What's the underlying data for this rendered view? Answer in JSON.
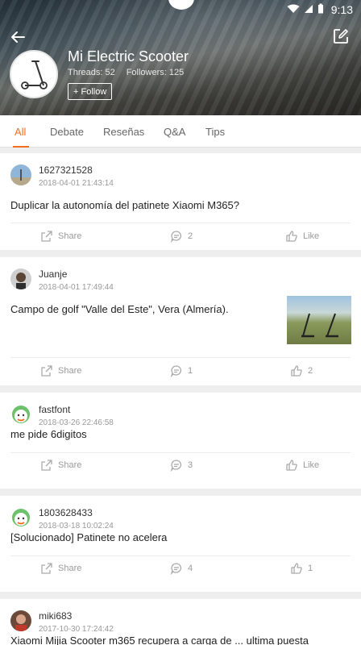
{
  "status_bar": {
    "time": "9:13"
  },
  "header": {
    "title": "Mi Electric Scooter",
    "threads": "Threads: 52",
    "followers": "Followers: 125",
    "follow_label": "+ Follow"
  },
  "tabs": [
    {
      "label": "All"
    },
    {
      "label": "Debate"
    },
    {
      "label": "Reseñas"
    },
    {
      "label": "Q&A"
    },
    {
      "label": "Tips"
    }
  ],
  "posts": [
    {
      "user": "1627321528",
      "time": "2018-04-01 21:43:14",
      "text": "Duplicar la autonomía del patinete Xiaomi M365?",
      "share": "Share",
      "comments": "2",
      "likes": "Like"
    },
    {
      "user": "Juanje",
      "time": "2018-04-01 17:49:44",
      "text": "Campo de golf \"Valle del Este\", Vera (Almería).",
      "share": "Share",
      "comments": "1",
      "likes": "2"
    },
    {
      "user": "fastfont",
      "time": "2018-03-26 22:46:58",
      "text": "me pide 6digitos",
      "share": "Share",
      "comments": "3",
      "likes": "Like"
    },
    {
      "user": "1803628433",
      "time": "2018-03-18 10:02:24",
      "text": "[Solucionado] Patinete no acelera",
      "share": "Share",
      "comments": "4",
      "likes": "1"
    },
    {
      "user": "miki683",
      "time": "2017-10-30 17:24:42",
      "text": "Xiaomi Mijia Scooter m365 recupera a carga de ... ultima puesta",
      "share": "",
      "comments": "",
      "likes": ""
    }
  ],
  "colors": {
    "accent": "#f26d21"
  }
}
